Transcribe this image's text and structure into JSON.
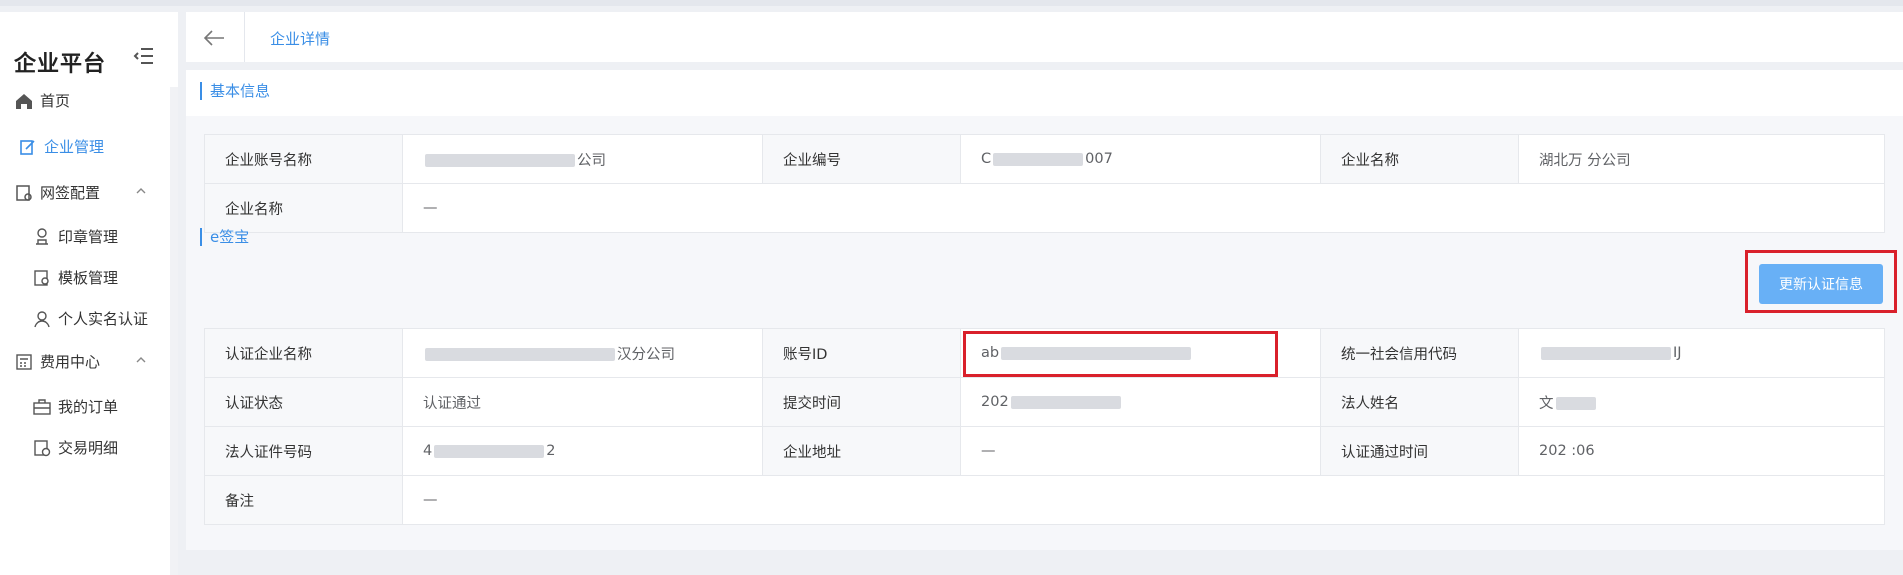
{
  "sidebar": {
    "brand": "企业平台",
    "items": [
      {
        "label": "首页"
      },
      {
        "label": "企业管理"
      },
      {
        "label": "网签配置"
      },
      {
        "label": "印章管理"
      },
      {
        "label": "模板管理"
      },
      {
        "label": "个人实名认证"
      },
      {
        "label": "费用中心"
      },
      {
        "label": "我的订单"
      },
      {
        "label": "交易明细"
      }
    ]
  },
  "tabs": {
    "active": "企业详情"
  },
  "basic": {
    "title": "基本信息",
    "rows": [
      [
        {
          "label": "企业账号名称",
          "value": "公司"
        },
        {
          "label": "企业编号",
          "value": "007"
        },
        {
          "label": "企业名称",
          "value": "湖北万 分公司"
        }
      ],
      [
        {
          "label": "企业名称",
          "value": "—"
        }
      ]
    ]
  },
  "esign": {
    "title": "e签宝",
    "update_button": "更新认证信息",
    "rows": [
      [
        {
          "label": "认证企业名称",
          "value": "汉分公司"
        },
        {
          "label": "账号ID",
          "value": "ab"
        },
        {
          "label": "统一社会信用代码",
          "value": "IJ"
        }
      ],
      [
        {
          "label": "认证状态",
          "value": "认证通过"
        },
        {
          "label": "提交时间",
          "value": "202"
        },
        {
          "label": "法人姓名",
          "value": "文"
        }
      ],
      [
        {
          "label": "法人证件号码",
          "value": "2"
        },
        {
          "label": "企业地址",
          "value": "—"
        },
        {
          "label": "认证通过时间",
          "value": "202 :06"
        }
      ],
      [
        {
          "label": "备注",
          "value": "—"
        }
      ]
    ]
  },
  "colors": {
    "accent": "#3a8ee6",
    "highlight": "#d9202b",
    "button": "#68b0f6"
  }
}
